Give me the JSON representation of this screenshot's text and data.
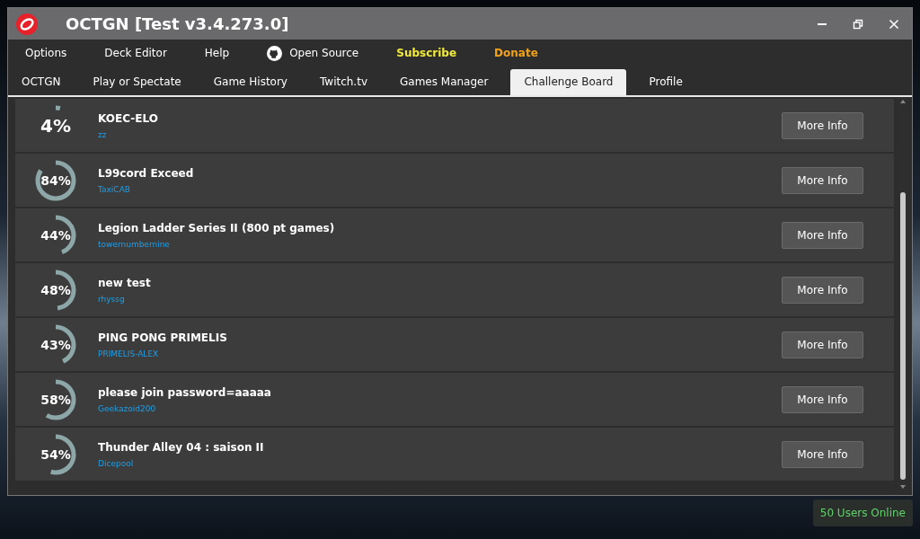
{
  "window": {
    "title": "OCTGN [Test v3.4.273.0]"
  },
  "menu": [
    {
      "label": "Options",
      "color": "#ffffff",
      "icon": false
    },
    {
      "label": "Deck Editor",
      "color": "#ffffff",
      "icon": false
    },
    {
      "label": "Help",
      "color": "#ffffff",
      "icon": false
    },
    {
      "label": "Open Source",
      "color": "#ffffff",
      "icon": true
    },
    {
      "label": "Subscribe",
      "color": "#f2ea3c",
      "icon": false
    },
    {
      "label": "Donate",
      "color": "#f5a21a",
      "icon": false
    }
  ],
  "tabs": [
    {
      "label": "OCTGN",
      "selected": false
    },
    {
      "label": "Play or Spectate",
      "selected": false
    },
    {
      "label": "Game History",
      "selected": false
    },
    {
      "label": "Twitch.tv",
      "selected": false
    },
    {
      "label": "Games Manager",
      "selected": false
    },
    {
      "label": "Challenge Board",
      "selected": true
    },
    {
      "label": "Profile",
      "selected": false
    }
  ],
  "challenges": [
    {
      "percent": "4%",
      "level": 0.04,
      "name": "KOEC-ELO",
      "user": "zz",
      "button": "More Info"
    },
    {
      "percent": "84%",
      "level": 0.84,
      "name": "L99cord Exceed",
      "user": "TaxiCAB",
      "button": "More Info"
    },
    {
      "percent": "44%",
      "level": 0.44,
      "name": "Legion Ladder Series II (800 pt games)",
      "user": "towernumbernine",
      "button": "More Info"
    },
    {
      "percent": "48%",
      "level": 0.48,
      "name": "new test",
      "user": "rhyssg",
      "button": "More Info"
    },
    {
      "percent": "43%",
      "level": 0.43,
      "name": "PING PONG PRIMELIS",
      "user": "PRIMELIS-ALEX",
      "button": "More Info"
    },
    {
      "percent": "58%",
      "level": 0.58,
      "name": "please join password=aaaaa",
      "user": "Geekazoid200",
      "button": "More Info"
    },
    {
      "percent": "54%",
      "level": 0.54,
      "name": "Thunder Alley 04 : saison II",
      "user": "Dicepool",
      "button": "More Info"
    }
  ],
  "status": {
    "users_online": "50 Users Online"
  }
}
